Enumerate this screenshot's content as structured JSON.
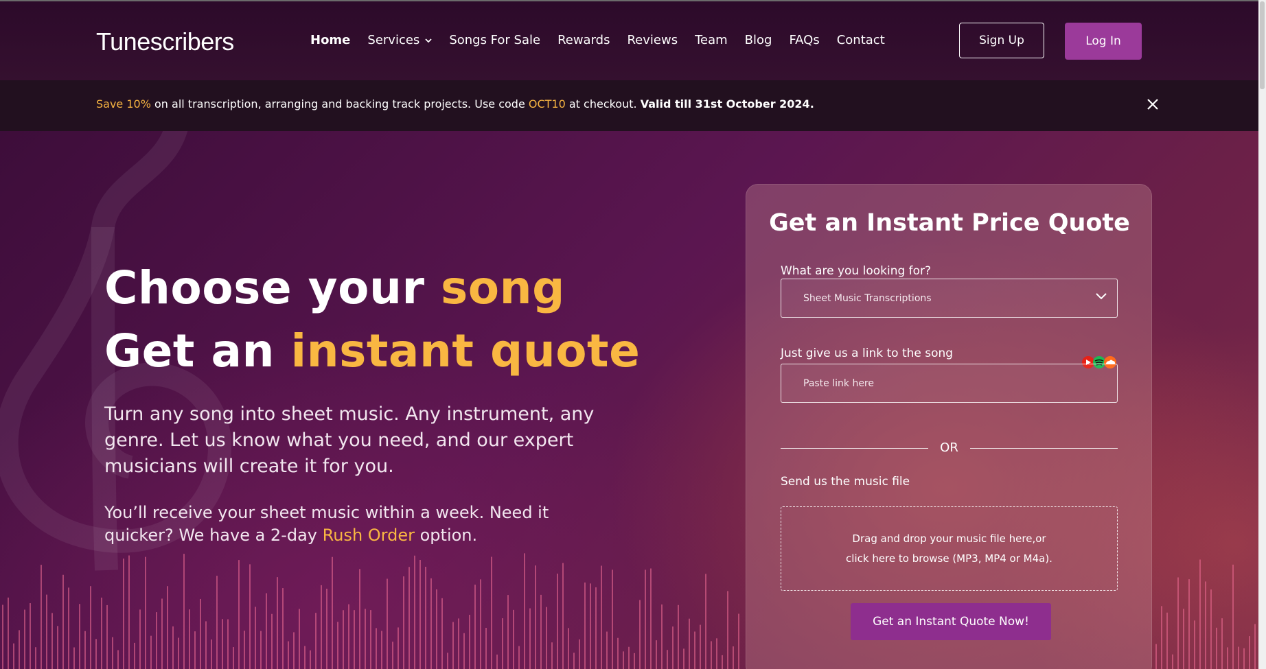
{
  "header": {
    "logo": "Tunescribers",
    "nav": [
      {
        "label": "Home"
      },
      {
        "label": "Services"
      },
      {
        "label": "Songs For Sale"
      },
      {
        "label": "Rewards"
      },
      {
        "label": "Reviews"
      },
      {
        "label": "Team"
      },
      {
        "label": "Blog"
      },
      {
        "label": "FAQs"
      },
      {
        "label": "Contact"
      }
    ],
    "signup": "Sign Up",
    "login": "Log In"
  },
  "promo": {
    "save": "Save 10%",
    "text1": " on all transcription, arranging and backing track projects. Use code ",
    "code": "OCT10",
    "text2": " at checkout. ",
    "valid": "Valid till 31st October 2024."
  },
  "hero": {
    "line1_a": "Choose your ",
    "line1_b": "song",
    "line2_a": "Get an ",
    "line2_b": "instant quote",
    "para1": "Turn any song into sheet music. Any instrument, any genre. Let us know what you need, and our expert musicians will create it for you.",
    "para2_a": "You’ll receive your sheet music within a week. Need it quicker? We have a 2-day ",
    "para2_link": "Rush Order",
    "para2_b": " option."
  },
  "quote": {
    "title": "Get an Instant Price Quote",
    "looking_label": "What are you looking for?",
    "looking_value": "Sheet Music Transcriptions",
    "link_label": "Just give us a link to the song",
    "link_placeholder": "Paste link here",
    "or": "OR",
    "file_label": "Send us the music file",
    "drop_line1": "Drag and drop your music file here,or",
    "drop_line2": "click here to browse (MP3, MP4 or M4a).",
    "button": "Get an Instant Quote Now!"
  },
  "colors": {
    "accent_yellow": "#f9b742",
    "button_purple": "#9b3a9a"
  }
}
